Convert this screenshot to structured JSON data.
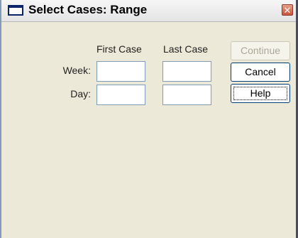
{
  "window": {
    "title": "Select Cases: Range",
    "close_glyph": "✕"
  },
  "columns": {
    "first": "First Case",
    "last": "Last Case"
  },
  "rows": [
    {
      "label": "Week:",
      "first_value": "",
      "last_value": ""
    },
    {
      "label": "Day:",
      "first_value": "",
      "last_value": ""
    }
  ],
  "buttons": {
    "continue": {
      "label": "Continue",
      "enabled": false
    },
    "cancel": {
      "label": "Cancel",
      "enabled": true
    },
    "help": {
      "label": "Help",
      "enabled": true,
      "focused": true
    }
  },
  "icons": {
    "app": "window-icon",
    "close": "close-icon"
  }
}
